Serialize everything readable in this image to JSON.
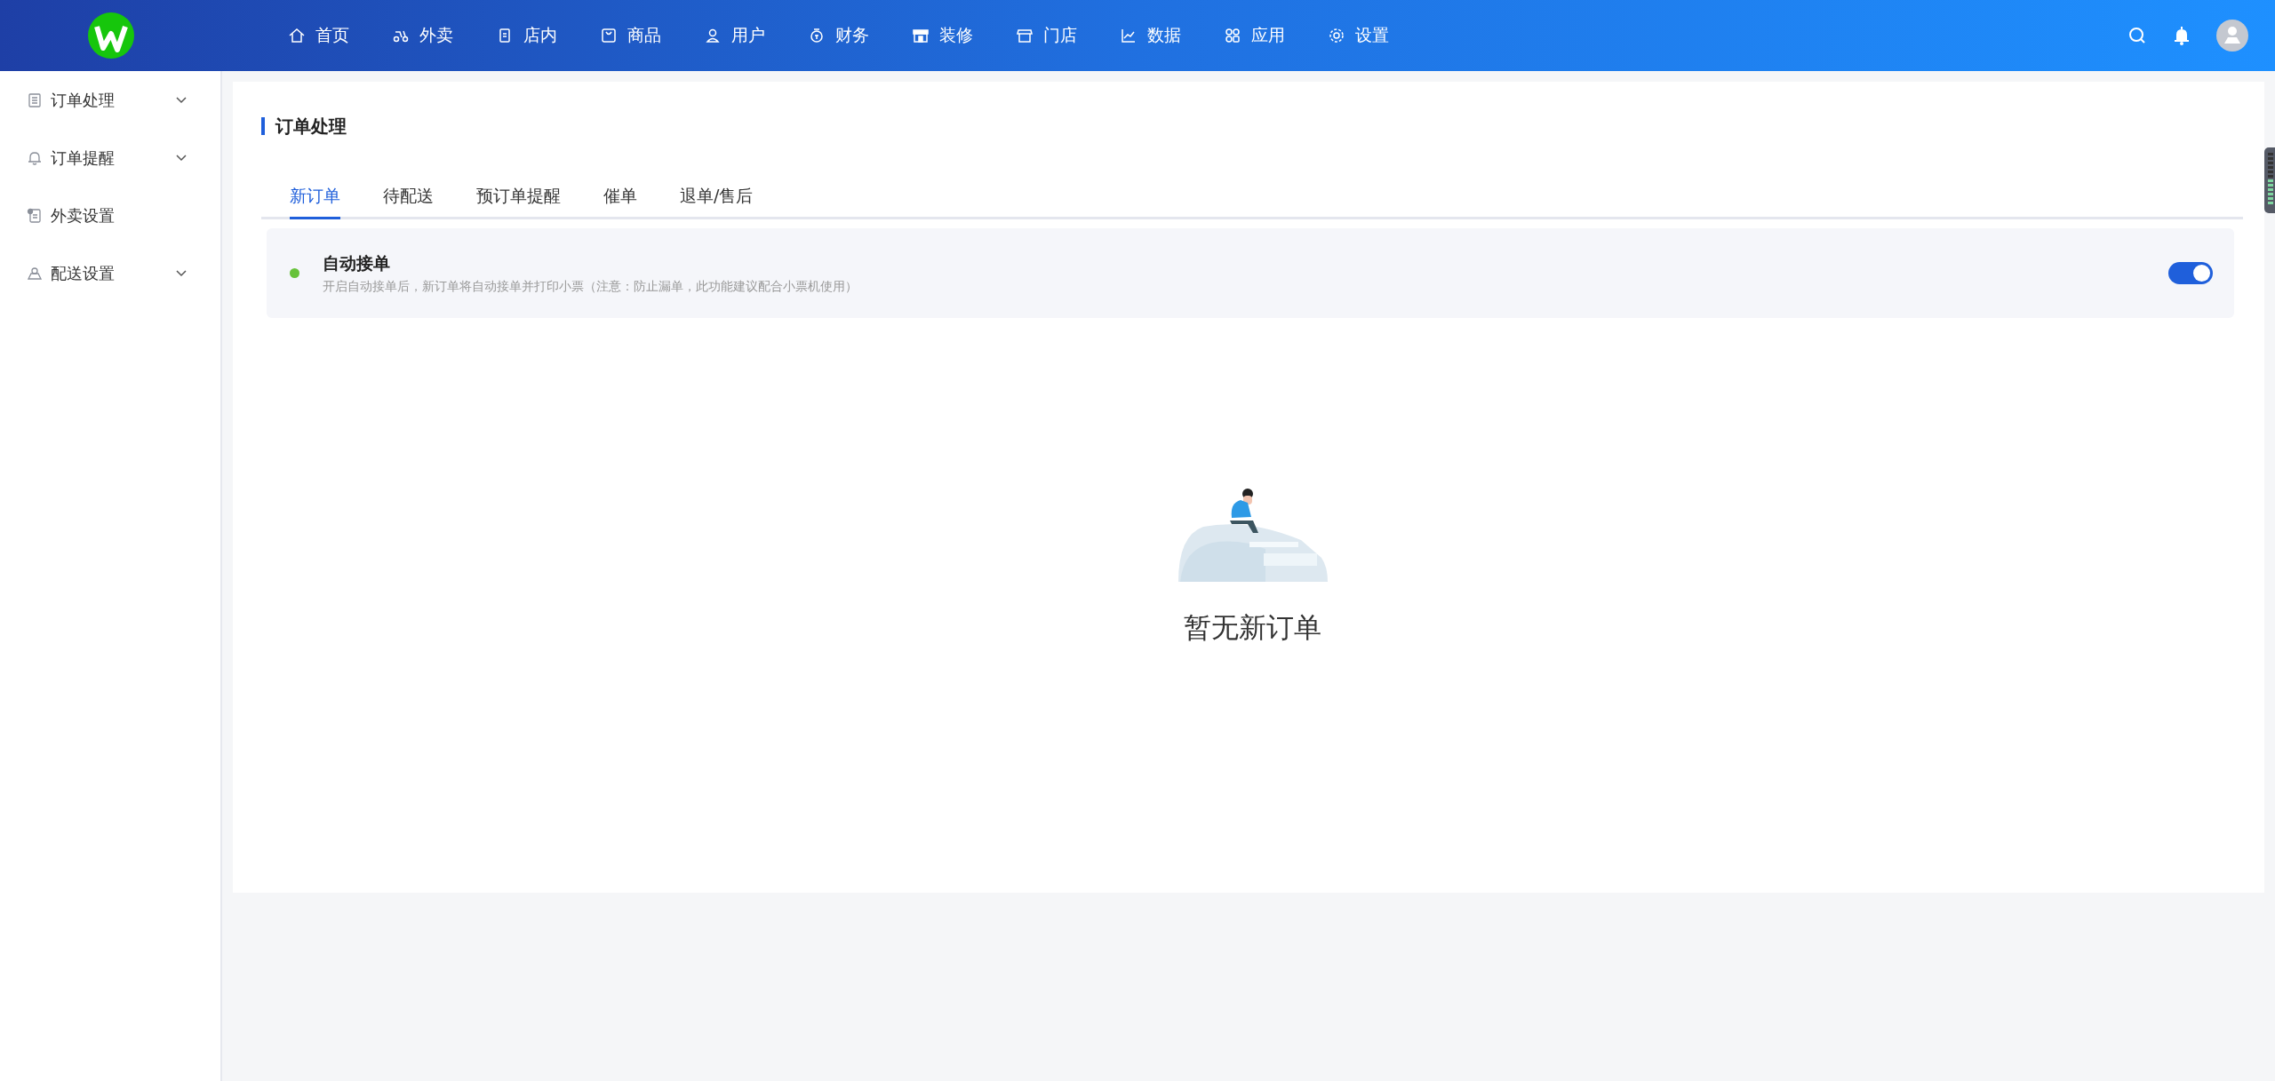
{
  "header": {
    "nav": [
      {
        "label": "首页"
      },
      {
        "label": "外卖"
      },
      {
        "label": "店内"
      },
      {
        "label": "商品"
      },
      {
        "label": "用户"
      },
      {
        "label": "财务"
      },
      {
        "label": "装修"
      },
      {
        "label": "门店"
      },
      {
        "label": "数据"
      },
      {
        "label": "应用"
      },
      {
        "label": "设置"
      }
    ]
  },
  "sidebar": {
    "items": [
      {
        "label": "订单处理",
        "expandable": true
      },
      {
        "label": "订单提醒",
        "expandable": true
      },
      {
        "label": "外卖设置",
        "expandable": false
      },
      {
        "label": "配送设置",
        "expandable": true
      }
    ]
  },
  "page": {
    "title": "订单处理",
    "tabs": [
      {
        "label": "新订单",
        "selected": true
      },
      {
        "label": "待配送",
        "selected": false
      },
      {
        "label": "预订单提醒",
        "selected": false
      },
      {
        "label": "催单",
        "selected": false
      },
      {
        "label": "退单/售后",
        "selected": false
      }
    ],
    "auto_accept": {
      "title": "自动接单",
      "description": "开启自动接单后，新订单将自动接单并打印小票（注意：防止漏单，此功能建议配合小票机使用）",
      "on": true
    },
    "empty_state": {
      "message": "暂无新订单"
    }
  }
}
